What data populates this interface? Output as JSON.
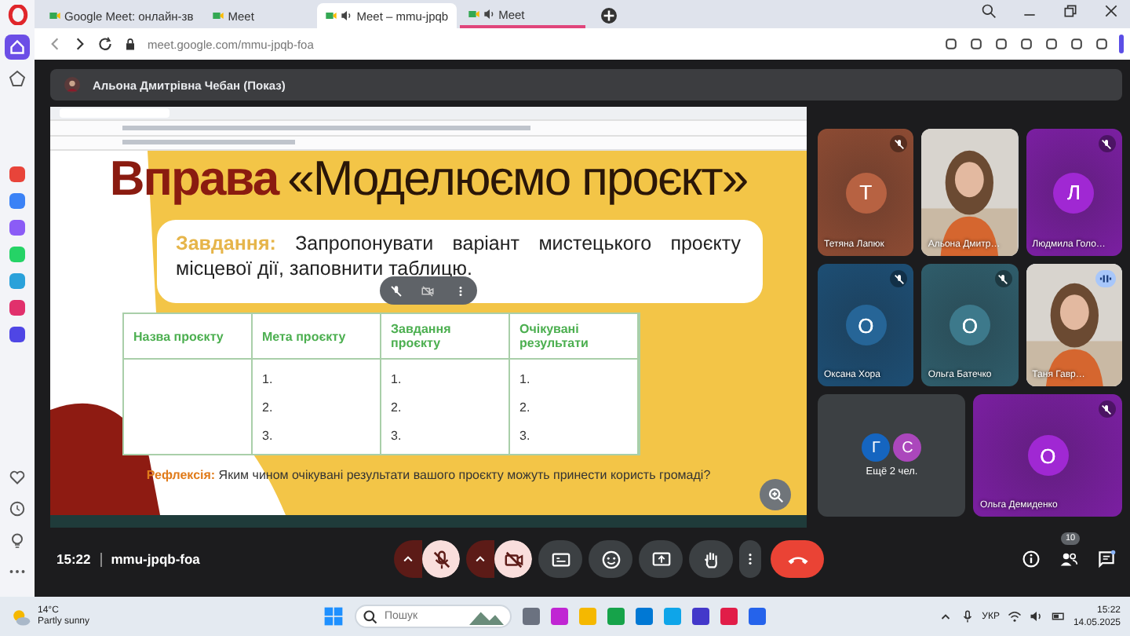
{
  "sidebar": {
    "apps": [
      {
        "color": "#e8443a"
      },
      {
        "color": "#3b82f6"
      },
      {
        "color": "#8b5cf6"
      },
      {
        "color": "#25d366"
      },
      {
        "color": "#2aa1da"
      },
      {
        "color": "#e1306c"
      },
      {
        "color": "#4f46e5"
      }
    ]
  },
  "tabs": [
    {
      "title": "Google Meet: онлайн-зв",
      "selected": false,
      "audio": false,
      "highlighted": false
    },
    {
      "title": "Meet",
      "selected": false,
      "audio": false,
      "highlighted": false
    },
    {
      "title": "Meet – mmu-jpqb",
      "selected": true,
      "audio": true,
      "highlighted": false
    },
    {
      "title": "Meet",
      "selected": false,
      "audio": true,
      "highlighted": true
    }
  ],
  "address_bar": {
    "url": "meet.google.com/mmu-jpqb-foa"
  },
  "presenter_bar": {
    "title": "Альона Дмитрівна Чебан (Показ)"
  },
  "slide": {
    "title_accent": "Вправа",
    "title_rest": "«Моделюємо проєкт»",
    "task_label": "Завдання:",
    "task_text": "Запропонувати варіант мистецького проєкту місцевої дії, заповнити таблицю.",
    "table": {
      "columns": [
        "Назва проєкту",
        "Мета проєкту",
        "Завдання проєкту",
        "Очікувані результати"
      ],
      "rows": [
        [
          "",
          "1.",
          "1.",
          "1."
        ],
        [
          "",
          "2.",
          "2.",
          "2."
        ],
        [
          "",
          "3.",
          "3.",
          "3."
        ]
      ]
    },
    "reflection_label": "Рефлексія:",
    "reflection_text": "Яким чином очікувані результати вашого проєкту можуть принести користь громаді?"
  },
  "tiles": [
    {
      "kind": "avatar",
      "name": "Тетяна Лапюк",
      "initial": "Т",
      "color": "#8d4b33",
      "muted": true,
      "speaking": false
    },
    {
      "kind": "video",
      "name": "Альона Дмитр…",
      "muted": false,
      "speaking": false
    },
    {
      "kind": "avatar",
      "name": "Людмила Голо…",
      "initial": "Л",
      "color": "#7b1fa2",
      "muted": true,
      "speaking": false
    },
    {
      "kind": "avatar",
      "name": "Оксана Хора",
      "initial": "О",
      "color": "#1d4e74",
      "muted": true,
      "speaking": false
    },
    {
      "kind": "avatar",
      "name": "Ольга Батечко",
      "initial": "О",
      "color": "#2f5d6b",
      "muted": true,
      "speaking": false
    },
    {
      "kind": "video",
      "name": "Таня Гавр…",
      "muted": false,
      "speaking": true
    },
    {
      "kind": "overflow",
      "label": "Ещё 2 чел.",
      "avatars": [
        {
          "initial": "Г",
          "color": "#1565c0"
        },
        {
          "initial": "С",
          "color": "#ab47bc"
        }
      ]
    },
    {
      "kind": "avatar",
      "name": "Ольга Демиденко",
      "initial": "О",
      "color": "#7b1fa2",
      "muted": true,
      "speaking": false
    }
  ],
  "call_bar": {
    "time": "15:22",
    "meeting_code": "mmu-jpqb-foa",
    "people_count": "10",
    "controls": [
      {
        "kind": "mic",
        "on": false
      },
      {
        "kind": "camera",
        "on": false
      },
      {
        "kind": "captions"
      },
      {
        "kind": "emoji"
      },
      {
        "kind": "present"
      },
      {
        "kind": "hand"
      },
      {
        "kind": "more"
      },
      {
        "kind": "end"
      }
    ]
  },
  "taskbar": {
    "temperature": "14°C",
    "weather": "Partly sunny",
    "search_placeholder": "Пошук",
    "apps": [
      {
        "color": "#6b7280"
      },
      {
        "color": "#c026d3"
      },
      {
        "color": "#f5b800"
      },
      {
        "color": "#16a34a"
      },
      {
        "color": "#0078d4"
      },
      {
        "color": "#0ea5e9"
      },
      {
        "color": "#4338ca"
      },
      {
        "color": "#e11d48"
      },
      {
        "color": "#2563eb"
      }
    ],
    "language": "УКР",
    "time": "15:22",
    "date": "14.05.2025"
  }
}
